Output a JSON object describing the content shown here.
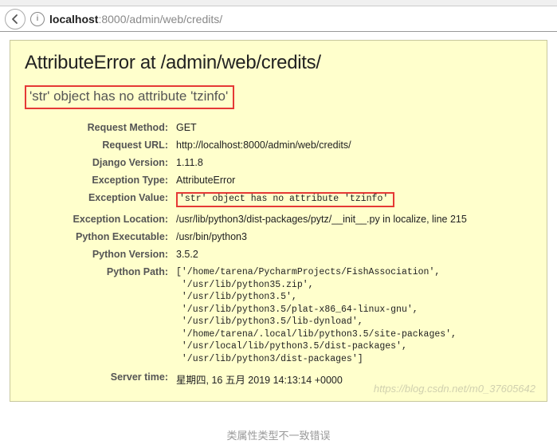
{
  "browser": {
    "url_host": "localhost",
    "url_port": ":8000",
    "url_path": "/admin/web/credits/"
  },
  "error": {
    "title": "AttributeError at /admin/web/credits/",
    "message": "'str' object has no attribute 'tzinfo'"
  },
  "meta": {
    "request_method": {
      "label": "Request Method:",
      "value": "GET"
    },
    "request_url": {
      "label": "Request URL:",
      "value": "http://localhost:8000/admin/web/credits/"
    },
    "django_version": {
      "label": "Django Version:",
      "value": "1.11.8"
    },
    "exception_type": {
      "label": "Exception Type:",
      "value": "AttributeError"
    },
    "exception_value": {
      "label": "Exception Value:",
      "value": "'str' object has no attribute 'tzinfo'"
    },
    "exception_location": {
      "label": "Exception Location:",
      "value": "/usr/lib/python3/dist-packages/pytz/__init__.py in localize, line 215"
    },
    "python_executable": {
      "label": "Python Executable:",
      "value": "/usr/bin/python3"
    },
    "python_version": {
      "label": "Python Version:",
      "value": "3.5.2"
    },
    "python_path": {
      "label": "Python Path:",
      "value": "['/home/tarena/PycharmProjects/FishAssociation',\n '/usr/lib/python35.zip',\n '/usr/lib/python3.5',\n '/usr/lib/python3.5/plat-x86_64-linux-gnu',\n '/usr/lib/python3.5/lib-dynload',\n '/home/tarena/.local/lib/python3.5/site-packages',\n '/usr/local/lib/python3.5/dist-packages',\n '/usr/lib/python3/dist-packages']"
    },
    "server_time": {
      "label": "Server time:",
      "value": "星期四, 16 五月 2019 14:13:14 +0000"
    }
  },
  "watermark": "https://blog.csdn.net/m0_37605642",
  "caption": "类属性类型不一致错误"
}
